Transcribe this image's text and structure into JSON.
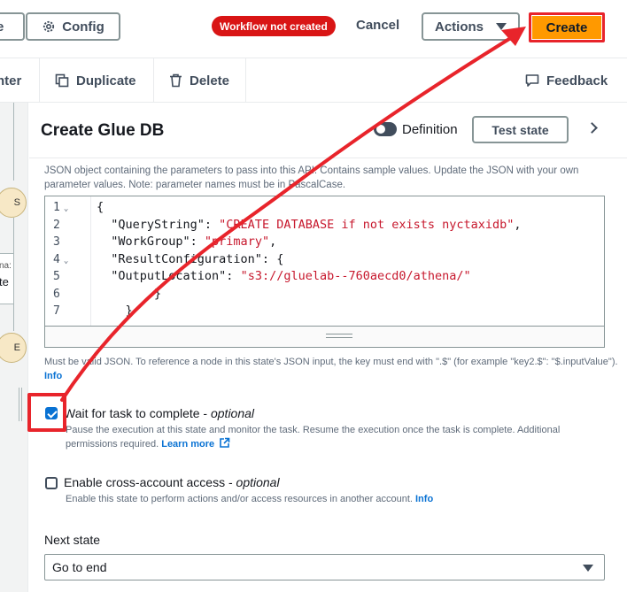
{
  "header": {
    "prev_label": "e",
    "config_label": "Config",
    "status_badge": "Workflow not created",
    "cancel_label": "Cancel",
    "actions_label": "Actions",
    "create_label": "Create"
  },
  "toolbar": {
    "cut_label": "nter",
    "duplicate_label": "Duplicate",
    "delete_label": "Delete",
    "feedback_label": "Feedback"
  },
  "canvas": {
    "node1_label": "S",
    "box_label_top": "na:",
    "box_label_bottom": "te",
    "node2_label": "E"
  },
  "panel": {
    "title": "Create Glue DB",
    "definition_label": "Definition",
    "test_state_label": "Test state",
    "description": "JSON object containing the parameters to pass into this API. Contains sample values. Update the JSON with your own parameter values. Note: parameter names must be in PascalCase.",
    "editor": {
      "line_numbers": [
        "1",
        "2",
        "3",
        "4",
        "5",
        "6",
        "7"
      ],
      "lines": [
        {
          "text": "{",
          "str": ""
        },
        {
          "text": "  \"QueryString\": ",
          "str": "\"CREATE DATABASE if not exists nyctaxidb\"",
          "tail": ","
        },
        {
          "text": "  \"WorkGroup\": ",
          "str": "\"primary\"",
          "tail": ","
        },
        {
          "text": "  \"ResultConfiguration\": {",
          "str": ""
        },
        {
          "text": "  \"OutputLocation\": ",
          "str": "\"s3://gluelab--760aecd0/athena/\"",
          "tail": ""
        },
        {
          "text": "        }",
          "str": ""
        },
        {
          "text": "    }",
          "str": ""
        }
      ]
    },
    "help_text": "Must be valid JSON. To reference a node in this state's JSON input, the key must end with \".$\" (for example \"key2.$\": \"$.inputValue\").",
    "info_label": "Info",
    "wait_label": "Wait for task to complete - ",
    "wait_optional": "optional",
    "wait_checked": true,
    "wait_desc": "Pause the execution at this state and monitor the task. Resume the execution once the task is complete. Additional permissions required.",
    "learn_more": "Learn more",
    "cross_label": "Enable cross-account access - ",
    "cross_optional": "optional",
    "cross_checked": false,
    "cross_desc": "Enable this state to perform actions and/or access resources in another account.",
    "cross_info": "Info",
    "next_state_label": "Next state",
    "next_state_value": "Go to end"
  },
  "colors": {
    "accent_orange": "#ff9900",
    "annotation_red": "#e8242b",
    "badge_red": "#d91515",
    "link_blue": "#0972d3",
    "string_red": "#c7182d"
  }
}
